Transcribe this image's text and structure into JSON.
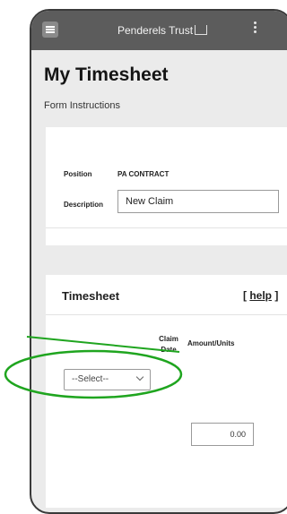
{
  "app": {
    "brand": "Penderels Trust",
    "title": "My Timesheet",
    "instructions_link": "Form Instructions"
  },
  "claim": {
    "position_label": "Position",
    "position_value": "PA CONTRACT",
    "description_label": "Description",
    "description_value": "New Claim"
  },
  "timesheet": {
    "title": "Timesheet",
    "help_open": "[",
    "help_label": "help",
    "help_close": "]",
    "col_claim": "Claim",
    "col_date": "Date",
    "col_amount": "Amount/Units",
    "select_value": "--Select--",
    "amount_value": "0.00"
  },
  "colors": {
    "topbar": "#5c5c5c",
    "annotation": "#1fa51f"
  },
  "icons": [
    "hamburger-menu-icon",
    "more-vertical-icon",
    "chevron-down-icon"
  ]
}
